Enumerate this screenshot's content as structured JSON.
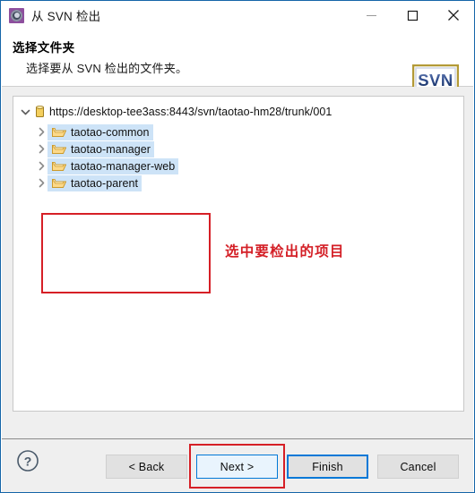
{
  "window": {
    "title": "从 SVN 检出",
    "icon": "svn-checkout-icon",
    "minimize_label": "—",
    "maximize_label": "□",
    "close_label": "✕"
  },
  "header": {
    "title": "选择文件夹",
    "subtitle": "选择要从 SVN 检出的文件夹。",
    "logo_text": "SVN"
  },
  "tree": {
    "root": {
      "label": "https://desktop-tee3ass:8443/svn/taotao-hm28/trunk/001",
      "expanded": true,
      "icon": "repository-icon"
    },
    "children": [
      {
        "label": "taotao-common",
        "selected": true,
        "icon": "folder-icon"
      },
      {
        "label": "taotao-manager",
        "selected": true,
        "icon": "folder-icon"
      },
      {
        "label": "taotao-manager-web",
        "selected": true,
        "icon": "folder-icon"
      },
      {
        "label": "taotao-parent",
        "selected": true,
        "icon": "folder-icon"
      }
    ]
  },
  "annotations": {
    "selection_note": "选中要检出的项目",
    "color": "#d41f26"
  },
  "footer": {
    "help_label": "?",
    "buttons": [
      {
        "label": "< Back",
        "state": "normal"
      },
      {
        "label": "Next >",
        "state": "focus"
      },
      {
        "label": "Finish",
        "state": "default"
      },
      {
        "label": "Cancel",
        "state": "normal"
      }
    ]
  },
  "colors": {
    "accent": "#0078d7",
    "window_border": "#1565a8",
    "selection": "#cde3f7",
    "annotation_red": "#d61f26",
    "panel_bg": "#efefef"
  }
}
